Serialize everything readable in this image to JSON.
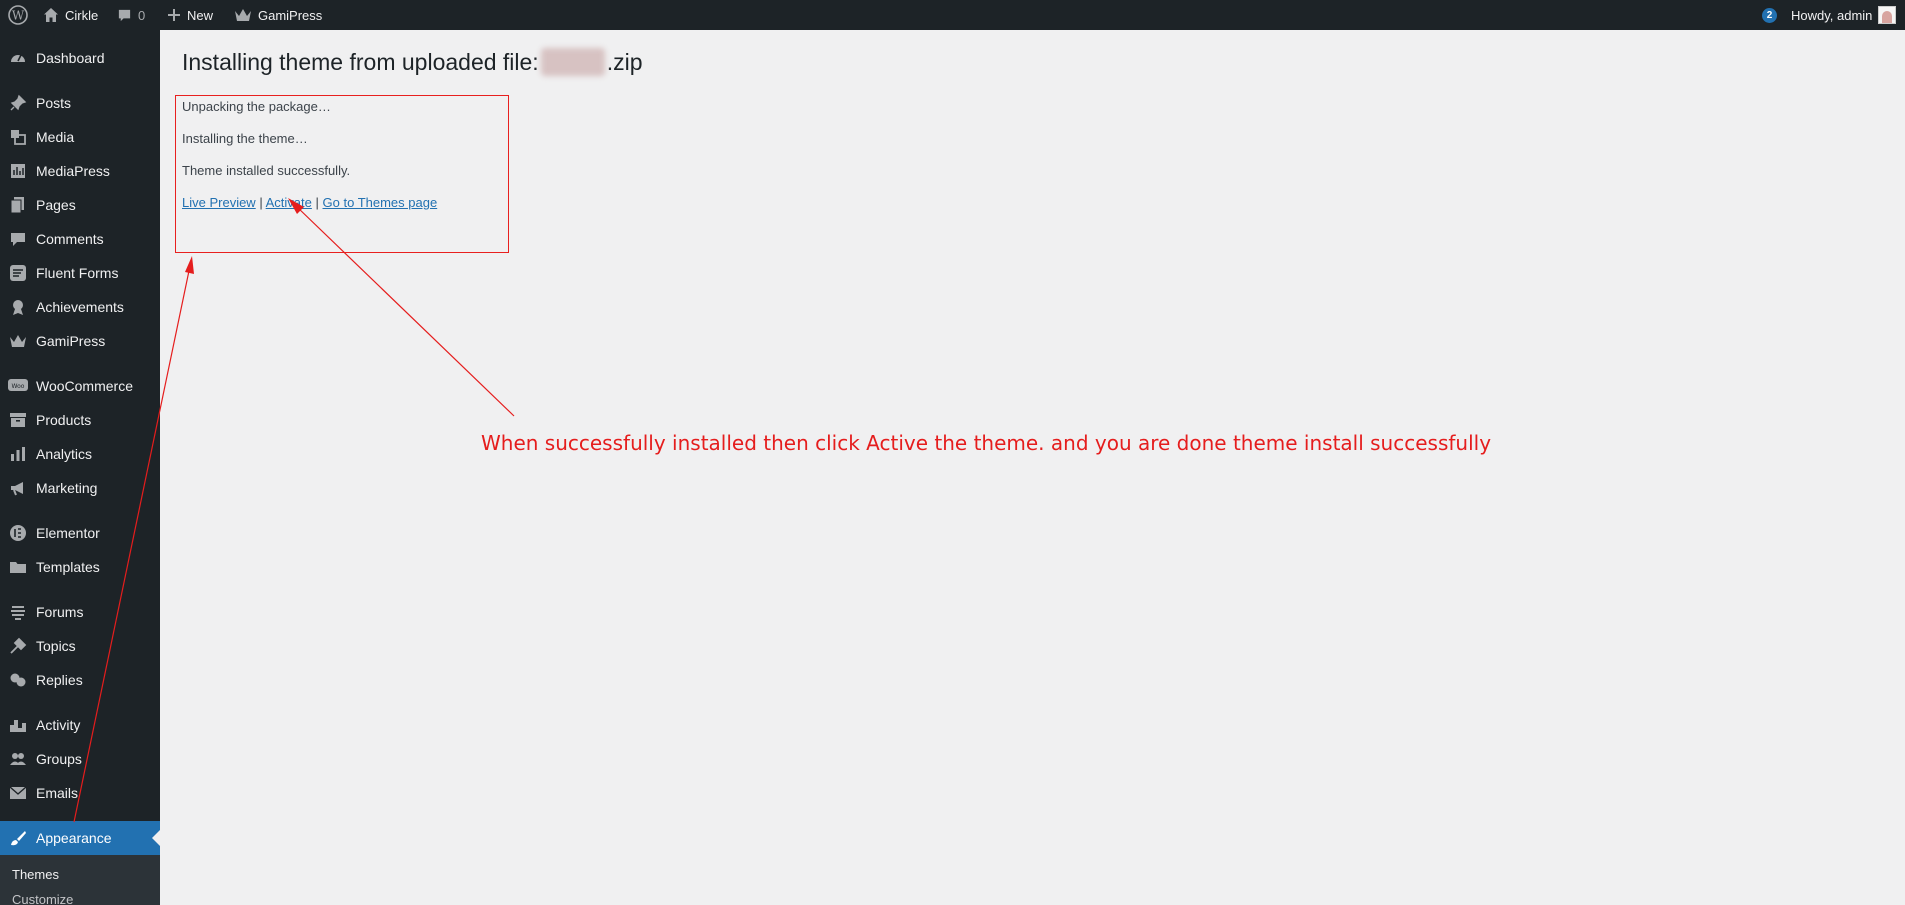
{
  "adminbar": {
    "site_name": "Cirkle",
    "comments_count": "0",
    "new_label": "New",
    "gamipress_label": "GamiPress",
    "updates_badge": "2",
    "greeting": "Howdy, admin"
  },
  "sidebar": {
    "items": [
      {
        "label": "Dashboard",
        "icon": "dashboard-icon"
      },
      {
        "label": "Posts",
        "icon": "pin-icon"
      },
      {
        "label": "Media",
        "icon": "media-icon"
      },
      {
        "label": "MediaPress",
        "icon": "image-gallery-icon"
      },
      {
        "label": "Pages",
        "icon": "pages-icon"
      },
      {
        "label": "Comments",
        "icon": "comment-icon"
      },
      {
        "label": "Fluent Forms",
        "icon": "form-icon"
      },
      {
        "label": "Achievements",
        "icon": "award-icon"
      },
      {
        "label": "GamiPress",
        "icon": "crown-icon"
      },
      {
        "label": "WooCommerce",
        "icon": "woo-icon"
      },
      {
        "label": "Products",
        "icon": "archive-icon"
      },
      {
        "label": "Analytics",
        "icon": "bar-chart-icon"
      },
      {
        "label": "Marketing",
        "icon": "megaphone-icon"
      },
      {
        "label": "Elementor",
        "icon": "elementor-icon"
      },
      {
        "label": "Templates",
        "icon": "folder-icon"
      },
      {
        "label": "Forums",
        "icon": "forums-icon"
      },
      {
        "label": "Topics",
        "icon": "topics-icon"
      },
      {
        "label": "Replies",
        "icon": "replies-icon"
      },
      {
        "label": "Activity",
        "icon": "activity-icon"
      },
      {
        "label": "Groups",
        "icon": "groups-icon"
      },
      {
        "label": "Emails",
        "icon": "email-icon"
      },
      {
        "label": "Appearance",
        "icon": "brush-icon",
        "current": true
      }
    ],
    "submenu": [
      "Themes",
      "Customize"
    ]
  },
  "main": {
    "heading_prefix": "Installing theme from uploaded file:",
    "heading_suffix": ".zip",
    "log": [
      "Unpacking the package…",
      "Installing the theme…",
      "Theme installed successfully."
    ],
    "links": {
      "live_preview": "Live Preview",
      "activate": "Activate",
      "themes_page": "Go to Themes page",
      "separator": "|"
    }
  },
  "annotation": {
    "text": "When successfully installed then click Active the theme. and you are done theme install successfully",
    "color": "#e51d1d"
  }
}
